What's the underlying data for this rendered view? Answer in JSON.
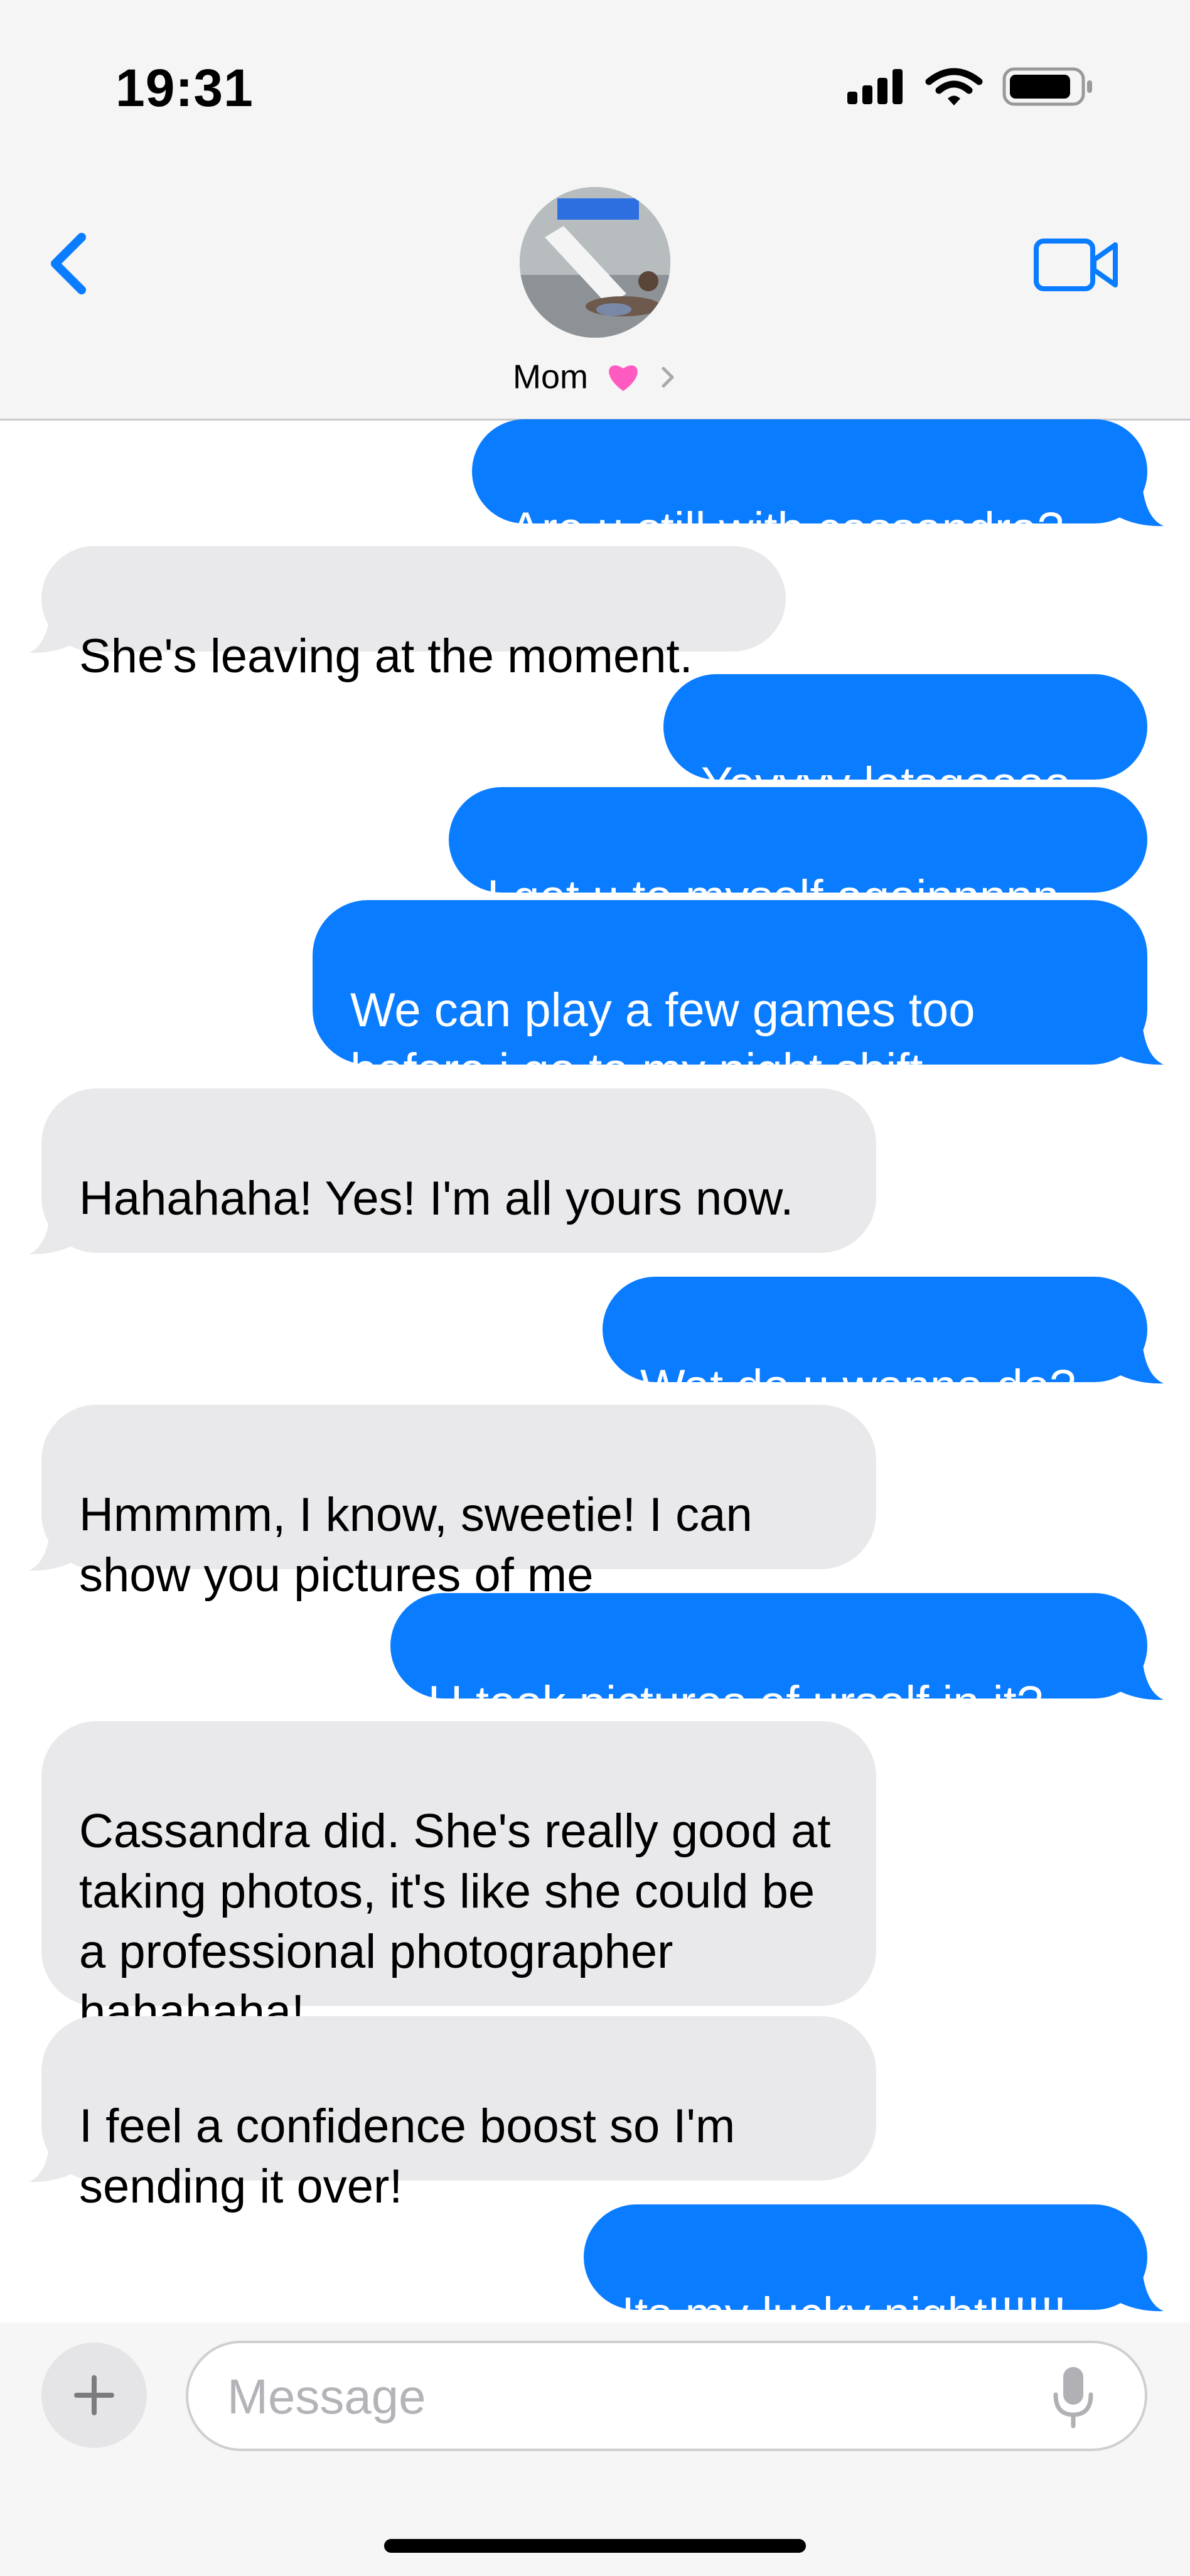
{
  "status_bar": {
    "time": "19:31"
  },
  "header": {
    "contact_name": "Mom",
    "name_emoji": "pink-heart-icon",
    "back_icon": "chevron-left-icon",
    "video_icon": "video-camera-icon"
  },
  "messages": [
    {
      "from": "me",
      "text": "Are u still with cassandra?"
    },
    {
      "from": "them",
      "text": "She's leaving at the moment."
    },
    {
      "from": "me",
      "text": "Yeyyyy letsgoooo"
    },
    {
      "from": "me",
      "text": "I get u to myself againnnnn"
    },
    {
      "from": "me",
      "text": "We can play a few games too before i go to my night shift"
    },
    {
      "from": "them",
      "text": "Hahahaha! Yes! I'm all yours now."
    },
    {
      "from": "me",
      "text": "Wat do u wanna do?"
    },
    {
      "from": "them",
      "text": "Hmmmm, I know, sweetie! I can show you pictures of me"
    },
    {
      "from": "me",
      "text": "U took pictures of urself in it?"
    },
    {
      "from": "them",
      "text": "Cassandra did. She's really good at taking photos, it's like she could be a professional photographer hahahaha!"
    },
    {
      "from": "them",
      "text": "I feel a confidence boost so I'm sending it over!"
    },
    {
      "from": "me",
      "text": "Its my lucky night!!!!!!"
    }
  ],
  "input": {
    "placeholder": "Message",
    "value": ""
  },
  "colors": {
    "outgoing_bubble": "#0a7cff",
    "incoming_bubble": "#e9e9eb",
    "accent": "#0a7cff",
    "heart": "#ff5ac0"
  }
}
